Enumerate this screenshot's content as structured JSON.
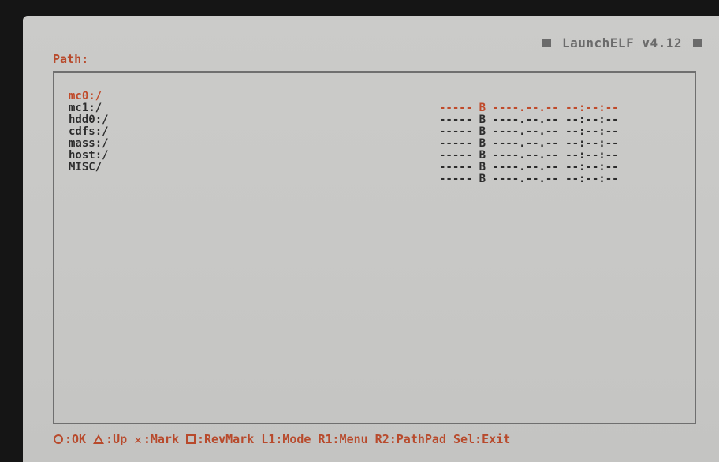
{
  "header": {
    "app_title": "LaunchELF v4.12",
    "path_label": "Path:"
  },
  "file_list": {
    "selected_index": 0,
    "rows": [
      {
        "name": "mc0:/",
        "info": "----- B ----.--.-- --:--:--"
      },
      {
        "name": "mc1:/",
        "info": "----- B ----.--.-- --:--:--"
      },
      {
        "name": "hdd0:/",
        "info": "----- B ----.--.-- --:--:--"
      },
      {
        "name": "cdfs:/",
        "info": "----- B ----.--.-- --:--:--"
      },
      {
        "name": "mass:/",
        "info": "----- B ----.--.-- --:--:--"
      },
      {
        "name": "host:/",
        "info": "----- B ----.--.-- --:--:--"
      },
      {
        "name": "MISC/",
        "info": "----- B ----.--.-- --:--:--"
      }
    ]
  },
  "footer": {
    "hints": [
      {
        "icon": "circle-icon",
        "label": ":OK"
      },
      {
        "icon": "triangle-icon",
        "label": ":Up"
      },
      {
        "icon": "cross-icon",
        "label": ":Mark"
      },
      {
        "icon": "square-icon",
        "label": ":RevMark"
      },
      {
        "icon": "",
        "label": "L1:Mode"
      },
      {
        "icon": "",
        "label": "R1:Menu"
      },
      {
        "icon": "",
        "label": "R2:PathPad"
      },
      {
        "icon": "",
        "label": "Sel:Exit"
      }
    ]
  },
  "colors": {
    "accent": "#b84a2c",
    "text": "#2c2c2c",
    "background": "#c8c8c6",
    "title_gray": "#6b6b6b"
  }
}
